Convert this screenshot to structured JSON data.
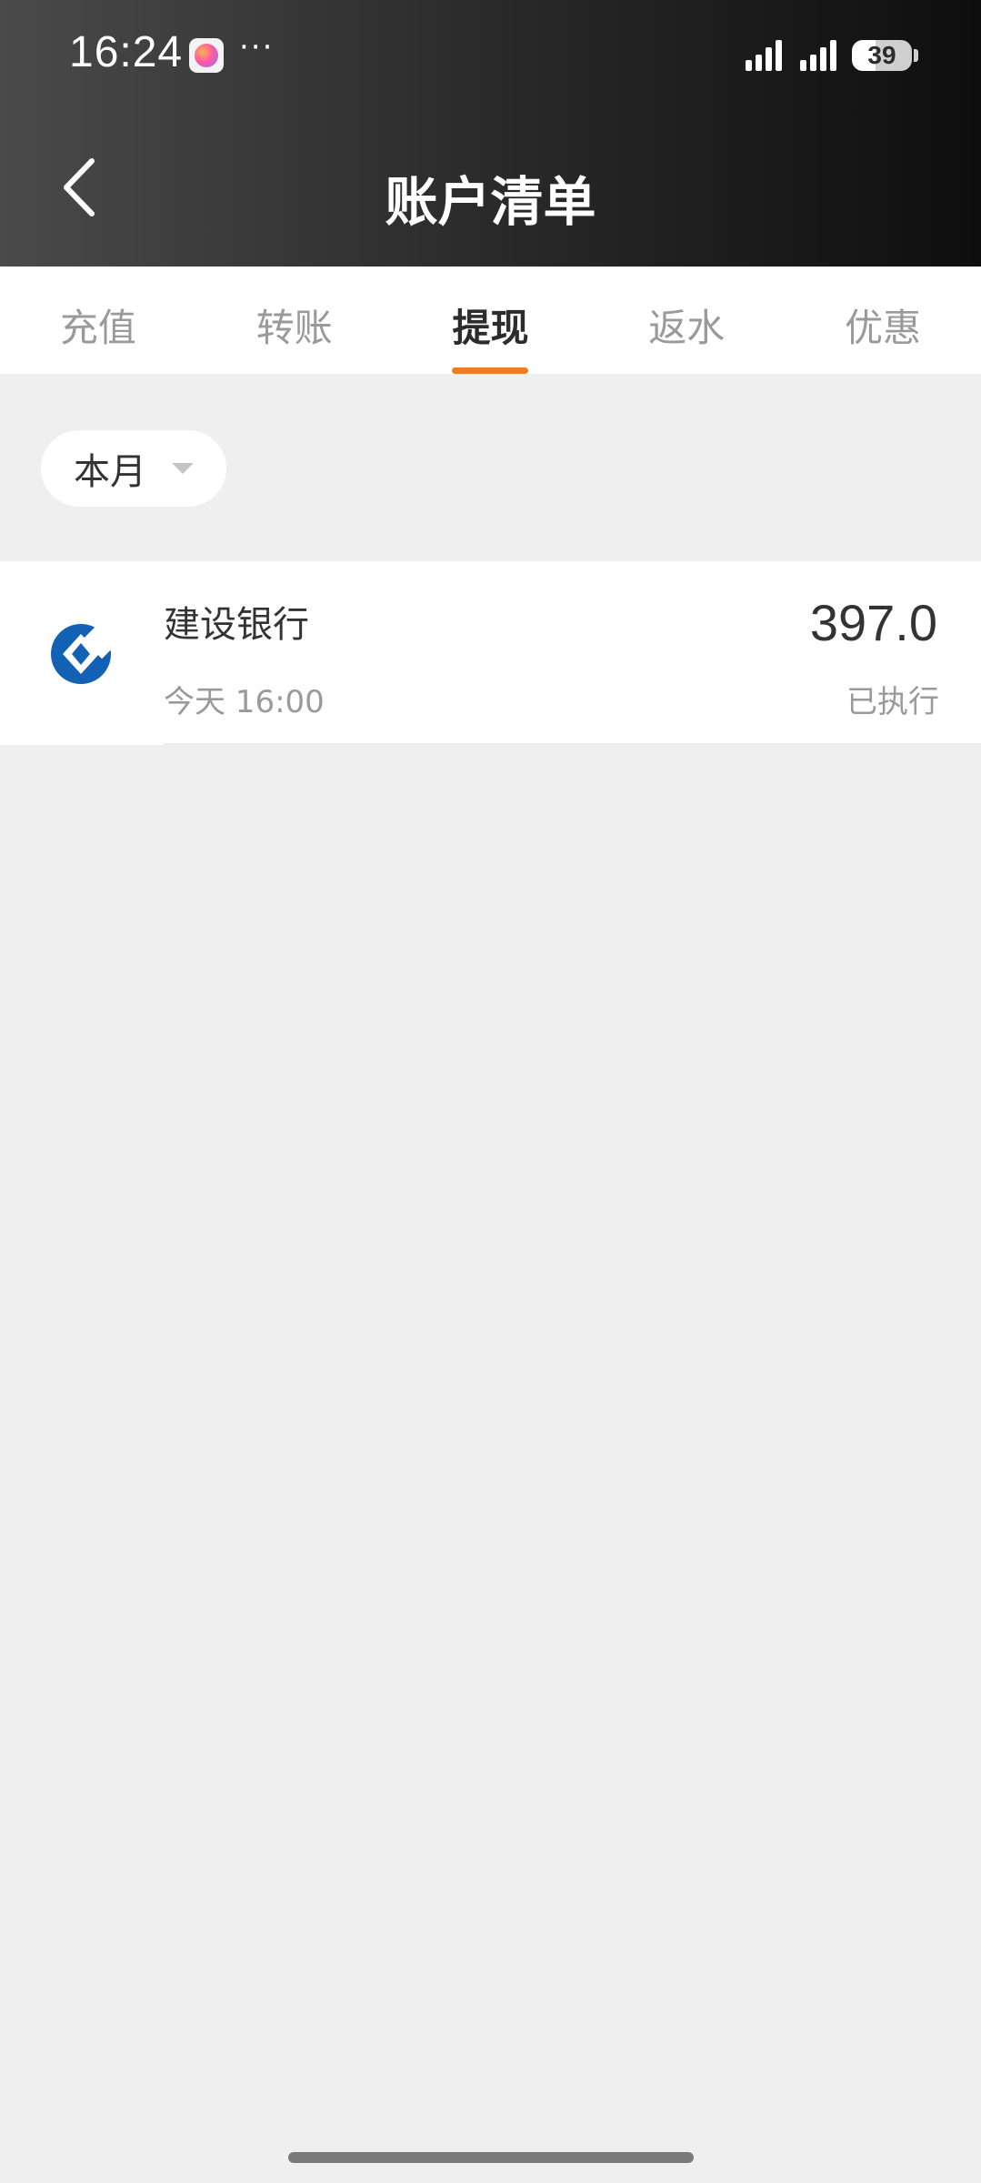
{
  "status_bar": {
    "time": "16:24",
    "more": "···",
    "battery_level": "39",
    "battery_fraction": 0.39
  },
  "header": {
    "title": "账户清单",
    "back_icon": "chevron-left-icon"
  },
  "tabs": [
    {
      "label": "充值",
      "active": false
    },
    {
      "label": "转账",
      "active": false
    },
    {
      "label": "提现",
      "active": true
    },
    {
      "label": "返水",
      "active": false
    },
    {
      "label": "优惠",
      "active": false
    }
  ],
  "filter": {
    "selected": "本月",
    "icon": "caret-down-icon"
  },
  "records": [
    {
      "bank_name": "建设银行",
      "time": "今天 16:00",
      "amount": "397.0",
      "status": "已执行",
      "logo": "ccb-bank-logo",
      "logo_color": "#1261b5"
    }
  ],
  "colors": {
    "accent": "#f07b23",
    "header_dark": "#0e0e0e",
    "header_light": "#4a4a4a",
    "background": "#efefef"
  }
}
